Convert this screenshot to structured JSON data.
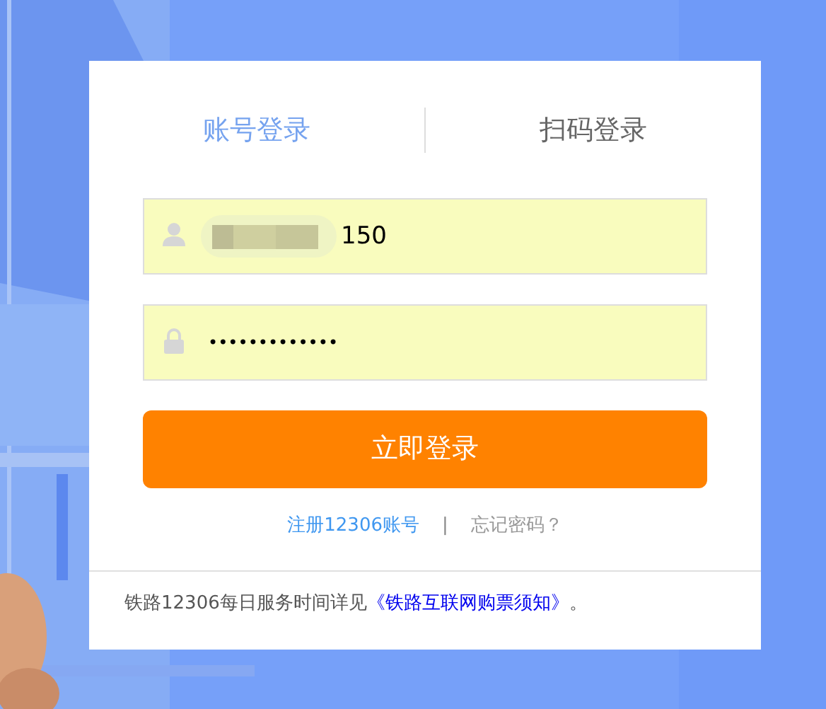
{
  "tabs": [
    {
      "label": "账号登录",
      "selected": true
    },
    {
      "label": "扫码登录",
      "selected": false
    }
  ],
  "username": {
    "value": "150",
    "redacted": true
  },
  "password": {
    "value": "•••••••••••••"
  },
  "login_button": "立即登录",
  "links": [
    {
      "label": "注册12306账号",
      "kind": "primary"
    },
    {
      "label": "|",
      "kind": "separator"
    },
    {
      "label": "忘记密码？",
      "kind": "muted"
    }
  ],
  "notice": {
    "text": "铁路12306每日服务时间详见",
    "link": "《铁路互联网购票须知》",
    "end": "。"
  }
}
